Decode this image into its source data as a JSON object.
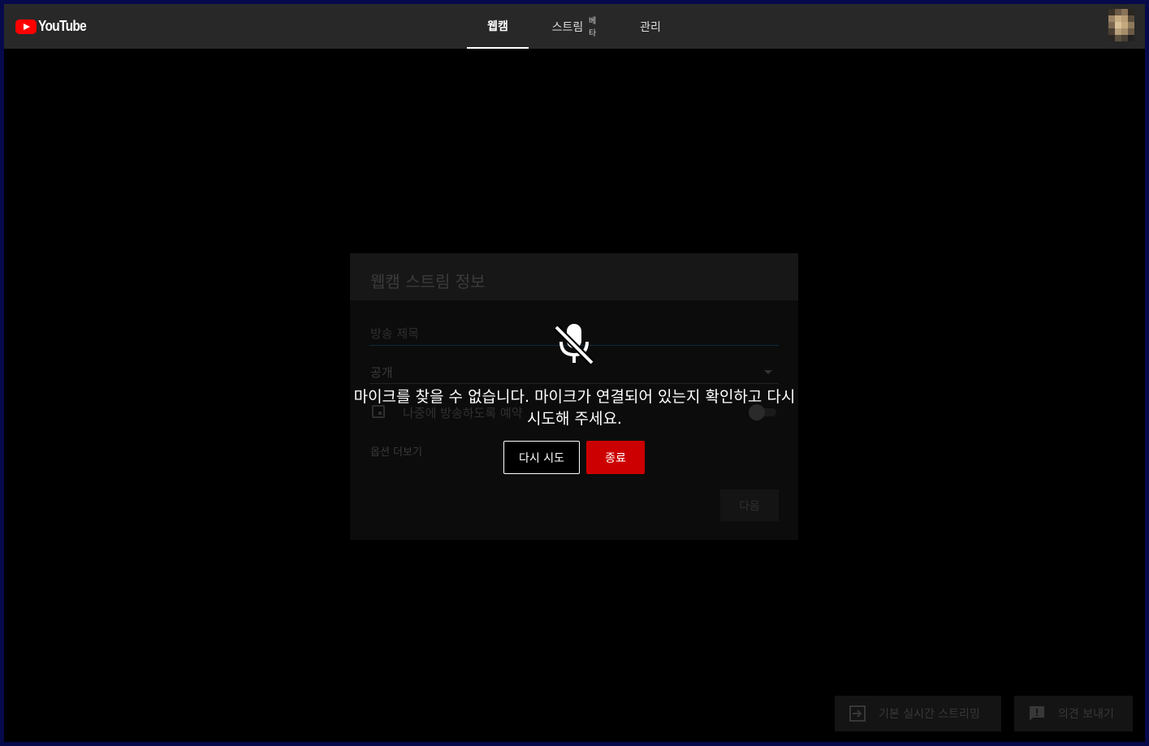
{
  "header": {
    "logo_text": "YouTube",
    "tabs": [
      {
        "label": "웹캠",
        "active": true
      },
      {
        "label": "스트림",
        "badge": "베타",
        "active": false
      },
      {
        "label": "관리",
        "active": false
      }
    ],
    "avatar_icon": "avatar-pixelated"
  },
  "card": {
    "title": "웹캠 스트림 정보",
    "title_placeholder": "방송 제목",
    "visibility_value": "공개",
    "schedule_label": "나중에 방송하도록 예약",
    "more_options": "옵션 더보기",
    "next_label": "다음"
  },
  "error": {
    "icon": "mic-off-icon",
    "message": "마이크를 찾을 수 없습니다. 마이크가 연결되어 있는지 확인하고 다시 시도해 주세요.",
    "retry_label": "다시 시도",
    "exit_label": "종료"
  },
  "footer": {
    "classic_label": "기본 실시간 스트리밍",
    "feedback_label": "의견 보내기"
  },
  "colors": {
    "accent": "#cc0000",
    "background": "#000000",
    "header_bg": "#282828"
  }
}
